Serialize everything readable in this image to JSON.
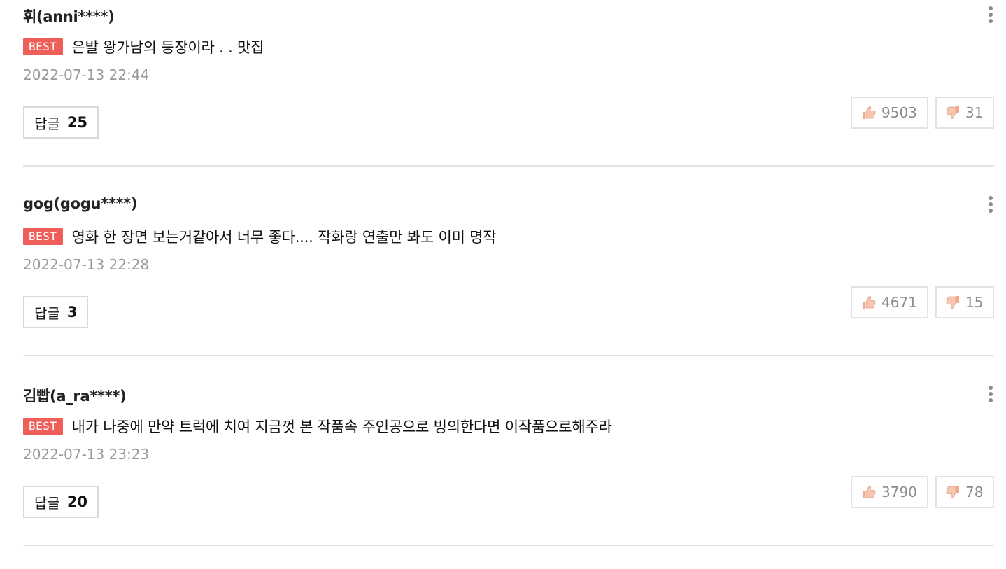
{
  "comments": [
    {
      "author": "휘(anni****)",
      "badge": "BEST",
      "text": "은발 왕가남의 등장이라 . . 맛집",
      "date": "2022-07-13 22:44",
      "reply_label": "답글",
      "reply_count": "25",
      "likes": "9503",
      "dislikes": "31"
    },
    {
      "author": "gog(gogu****)",
      "badge": "BEST",
      "text": "영화 한 장면 보는거같아서 너무 좋다.... 작화랑 연출만 봐도 이미 명작",
      "date": "2022-07-13 22:28",
      "reply_label": "답글",
      "reply_count": "3",
      "likes": "4671",
      "dislikes": "15"
    },
    {
      "author": "김빱(a_ra****)",
      "badge": "BEST",
      "text": "내가 나중에 만약 트럭에 치여 지금껏 본 작품속 주인공으로 빙의한다면 이작품으로해주라",
      "date": "2022-07-13 23:23",
      "reply_label": "답글",
      "reply_count": "20",
      "likes": "3790",
      "dislikes": "78"
    }
  ],
  "icons": {
    "like": "thumbs-up-icon",
    "dislike": "thumbs-down-icon",
    "more": "more-vertical-icon"
  },
  "colors": {
    "best_badge": "#ed5f58",
    "timestamp": "#9a9a9a",
    "vote_count": "#8c8c8c",
    "thumb": "#f3b49b"
  }
}
